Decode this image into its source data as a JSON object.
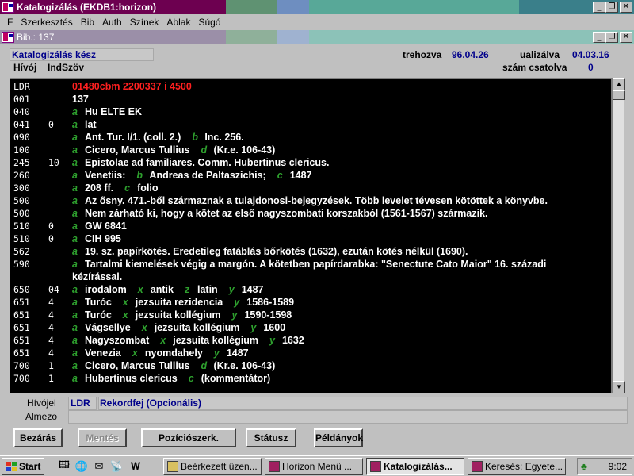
{
  "window": {
    "title": "Katalogizálás (EKDB1:horizon)"
  },
  "menu": [
    "F",
    "Szerkesztés",
    "Bib",
    "Auth",
    "Színek",
    "Ablak",
    "Súgó"
  ],
  "child_window": {
    "title": "Bib.: 137"
  },
  "header": {
    "status": "Katalogizálás kész",
    "created_label": "trehozva",
    "created_value": "96.04.26",
    "updated_label": "ualizálva",
    "updated_value": "04.03.16",
    "attached_label": "szám csatolva",
    "attached_value": "0",
    "col_tag": "Hívój",
    "col_ind": "Ind",
    "col_text": "Szöv"
  },
  "records": [
    {
      "tag": "LDR",
      "ind": "",
      "leader": "01480cbm  2200337 i 4500"
    },
    {
      "tag": "001",
      "ind": "",
      "plain": "137"
    },
    {
      "tag": "040",
      "ind": "",
      "subfields": [
        {
          "code": "a",
          "text": "Hu ELTE EK"
        }
      ]
    },
    {
      "tag": "041",
      "ind": "0",
      "subfields": [
        {
          "code": "a",
          "text": "lat"
        }
      ]
    },
    {
      "tag": "090",
      "ind": "",
      "subfields": [
        {
          "code": "a",
          "text": "Ant. Tur. I/1. (coll. 2.)"
        },
        {
          "code": "b",
          "text": "Inc. 256."
        }
      ]
    },
    {
      "tag": "100",
      "ind": "",
      "subfields": [
        {
          "code": "a",
          "text": "Cicero, Marcus Tullius"
        },
        {
          "code": "d",
          "text": "(Kr.e. 106-43)"
        }
      ]
    },
    {
      "tag": "245",
      "ind": "10",
      "subfields": [
        {
          "code": "a",
          "text": "Epistolae ad familiares. Comm. Hubertinus clericus."
        }
      ]
    },
    {
      "tag": "260",
      "ind": "",
      "subfields": [
        {
          "code": "a",
          "text": "Venetiis:"
        },
        {
          "code": "b",
          "text": "Andreas de Paltaszichis;"
        },
        {
          "code": "c",
          "text": "1487"
        }
      ]
    },
    {
      "tag": "300",
      "ind": "",
      "subfields": [
        {
          "code": "a",
          "text": "208 ff."
        },
        {
          "code": "c",
          "text": "folio"
        }
      ]
    },
    {
      "tag": "500",
      "ind": "",
      "subfields": [
        {
          "code": "a",
          "text": "Az ősny. 471.-ből származnak a tulajdonosi-bejegyzések. Több levelet tévesen kötöttek a könyvbe."
        }
      ]
    },
    {
      "tag": "500",
      "ind": "",
      "subfields": [
        {
          "code": "a",
          "text": "Nem zárható ki, hogy a kötet az első nagyszombati korszakból (1561-1567) származik."
        }
      ]
    },
    {
      "tag": "510",
      "ind": "0",
      "subfields": [
        {
          "code": "a",
          "text": "GW 6841"
        }
      ]
    },
    {
      "tag": "510",
      "ind": "0",
      "subfields": [
        {
          "code": "a",
          "text": "CIH 995"
        }
      ]
    },
    {
      "tag": "562",
      "ind": "",
      "subfields": [
        {
          "code": "a",
          "text": "19. sz. papírkötés. Eredetileg fatáblás bőrkötés (1632), ezután kötés nélkül (1690)."
        }
      ]
    },
    {
      "tag": "590",
      "ind": "",
      "wrap": true,
      "subfields": [
        {
          "code": "a",
          "text": "Tartalmi kiemelések végig a margón. A kötetben papírdarabka: \"Senectute Cato Maior\" 16. századi kézírással."
        }
      ]
    },
    {
      "tag": "650",
      "ind": "04",
      "subfields": [
        {
          "code": "a",
          "text": "irodalom"
        },
        {
          "code": "x",
          "text": "antik"
        },
        {
          "code": "z",
          "text": "latin"
        },
        {
          "code": "y",
          "text": "1487"
        }
      ]
    },
    {
      "tag": "651",
      "ind": "4",
      "subfields": [
        {
          "code": "a",
          "text": "Turóc"
        },
        {
          "code": "x",
          "text": "jezsuita rezidencia"
        },
        {
          "code": "y",
          "text": "1586-1589"
        }
      ]
    },
    {
      "tag": "651",
      "ind": "4",
      "subfields": [
        {
          "code": "a",
          "text": "Turóc"
        },
        {
          "code": "x",
          "text": "jezsuita kollégium"
        },
        {
          "code": "y",
          "text": "1590-1598"
        }
      ]
    },
    {
      "tag": "651",
      "ind": "4",
      "subfields": [
        {
          "code": "a",
          "text": "Vágsellye"
        },
        {
          "code": "x",
          "text": "jezsuita kollégium"
        },
        {
          "code": "y",
          "text": "1600"
        }
      ]
    },
    {
      "tag": "651",
      "ind": "4",
      "subfields": [
        {
          "code": "a",
          "text": "Nagyszombat"
        },
        {
          "code": "x",
          "text": "jezsuita kollégium"
        },
        {
          "code": "y",
          "text": "1632"
        }
      ]
    },
    {
      "tag": "651",
      "ind": "4",
      "subfields": [
        {
          "code": "a",
          "text": "Venezia"
        },
        {
          "code": "x",
          "text": "nyomdahely"
        },
        {
          "code": "y",
          "text": "1487"
        }
      ]
    },
    {
      "tag": "700",
      "ind": "1",
      "subfields": [
        {
          "code": "a",
          "text": "Cicero, Marcus Tullius"
        },
        {
          "code": "d",
          "text": "(Kr.e. 106-43)"
        }
      ]
    },
    {
      "tag": "700",
      "ind": "1",
      "subfields": [
        {
          "code": "a",
          "text": "Hubertinus clericus"
        },
        {
          "code": "c",
          "text": "(kommentátor)"
        }
      ]
    }
  ],
  "footer": {
    "tag_label": "Hívójel",
    "tag_value": "LDR",
    "field_desc": "Rekordfej (Opcionális)",
    "subfield_label": "Almezo"
  },
  "buttons": {
    "close": "Bezárás",
    "save": "Mentés",
    "position": "Pozíciószerk.",
    "status": "Státusz",
    "copies": "Példányok"
  },
  "taskbar": {
    "start": "Start",
    "tasks": [
      "Beérkezett üzen...",
      "Horizon Menü ...",
      "Katalogizálás...",
      "Keresés: Egyete..."
    ],
    "clock": "9:02"
  },
  "colors": {
    "title_active": "#6d0050",
    "leader": "#ff2020",
    "subfield_code": "#2ea02e",
    "label_blue": "#00008b"
  }
}
